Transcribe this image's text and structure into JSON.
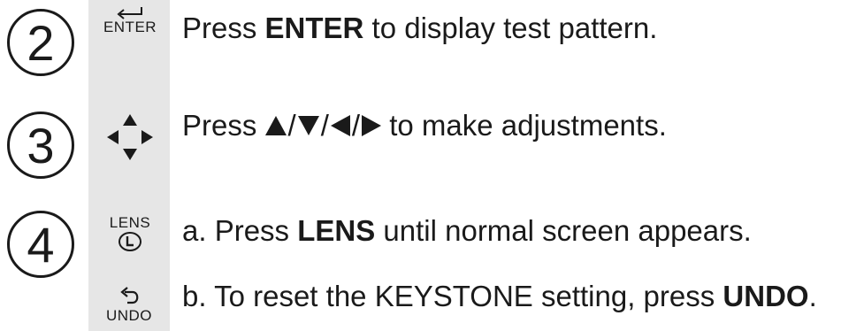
{
  "steps": [
    {
      "number": "2",
      "key_label": "ENTER",
      "icon": "enter-icon",
      "text": {
        "before": "Press ",
        "key": "ENTER",
        "after": " to display test pattern."
      }
    },
    {
      "number": "3",
      "icon": "direction-arrows-icon",
      "text": {
        "before": "Press ",
        "separator": "/",
        "after": " to make adjustments."
      }
    },
    {
      "number": "4",
      "substeps": [
        {
          "key_label": "LENS",
          "icon": "lens-icon",
          "text": {
            "before": "a. Press ",
            "key": "LENS",
            "after": " until normal screen appears."
          }
        },
        {
          "key_label": "UNDO",
          "icon": "undo-icon",
          "text": {
            "before": "b. To reset the KEYSTONE setting, press ",
            "key": "UNDO",
            "after": "."
          }
        }
      ]
    }
  ],
  "colors": {
    "text": "#1a1a1a",
    "icon_column": "#e6e6e6"
  }
}
